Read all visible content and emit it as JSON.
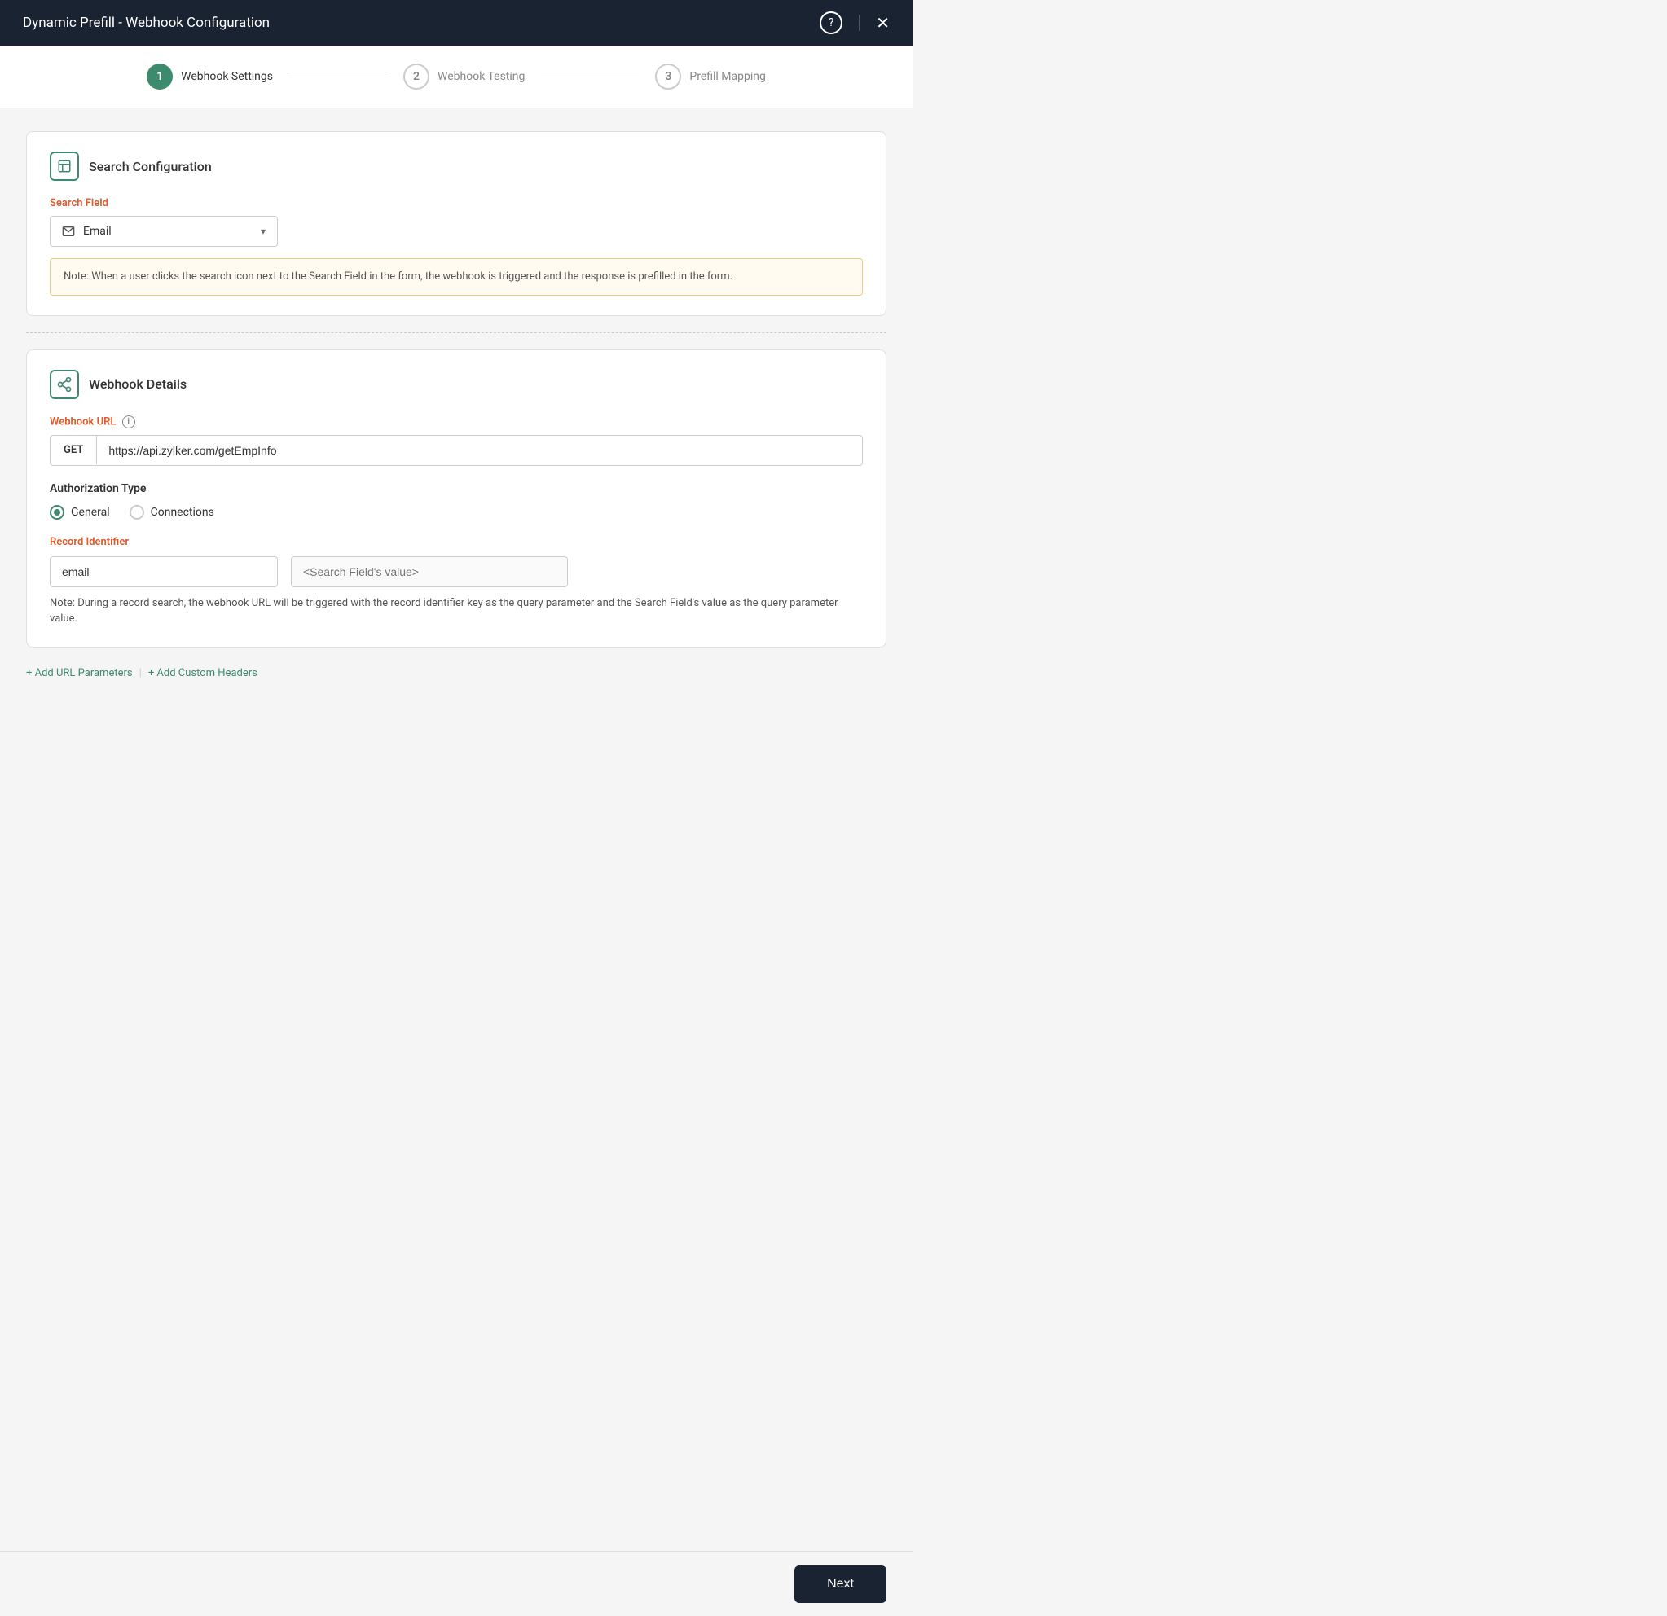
{
  "header": {
    "title": "Dynamic Prefill - Webhook Configuration",
    "help_icon": "?",
    "close_icon": "×"
  },
  "stepper": {
    "steps": [
      {
        "number": "1",
        "label": "Webhook Settings",
        "active": true
      },
      {
        "number": "2",
        "label": "Webhook Testing",
        "active": false
      },
      {
        "number": "3",
        "label": "Prefill Mapping",
        "active": false
      }
    ]
  },
  "search_config": {
    "section_title": "Search Configuration",
    "field_label": "Search Field",
    "dropdown_value": "Email",
    "note": "Note: When a user clicks the search icon next to the Search Field in the form, the webhook is triggered and the response is prefilled in the form."
  },
  "webhook_details": {
    "section_title": "Webhook Details",
    "url_label": "Webhook URL",
    "url_method": "GET",
    "url_value": "https://api.zylker.com/getEmpInfo",
    "auth_label": "Authorization Type",
    "auth_options": [
      {
        "label": "General",
        "checked": true
      },
      {
        "label": "Connections",
        "checked": false
      }
    ],
    "record_id_label": "Record Identifier",
    "record_id_key": "email",
    "record_id_placeholder": "<Search Field's value>",
    "record_note": "Note: During a record search, the webhook URL will be triggered with the record identifier key as the query parameter and the Search Field's value as the query parameter value."
  },
  "actions": {
    "add_url_params": "+ Add URL Parameters",
    "add_custom_headers": "+ Add Custom Headers"
  },
  "footer": {
    "next_label": "Next"
  }
}
